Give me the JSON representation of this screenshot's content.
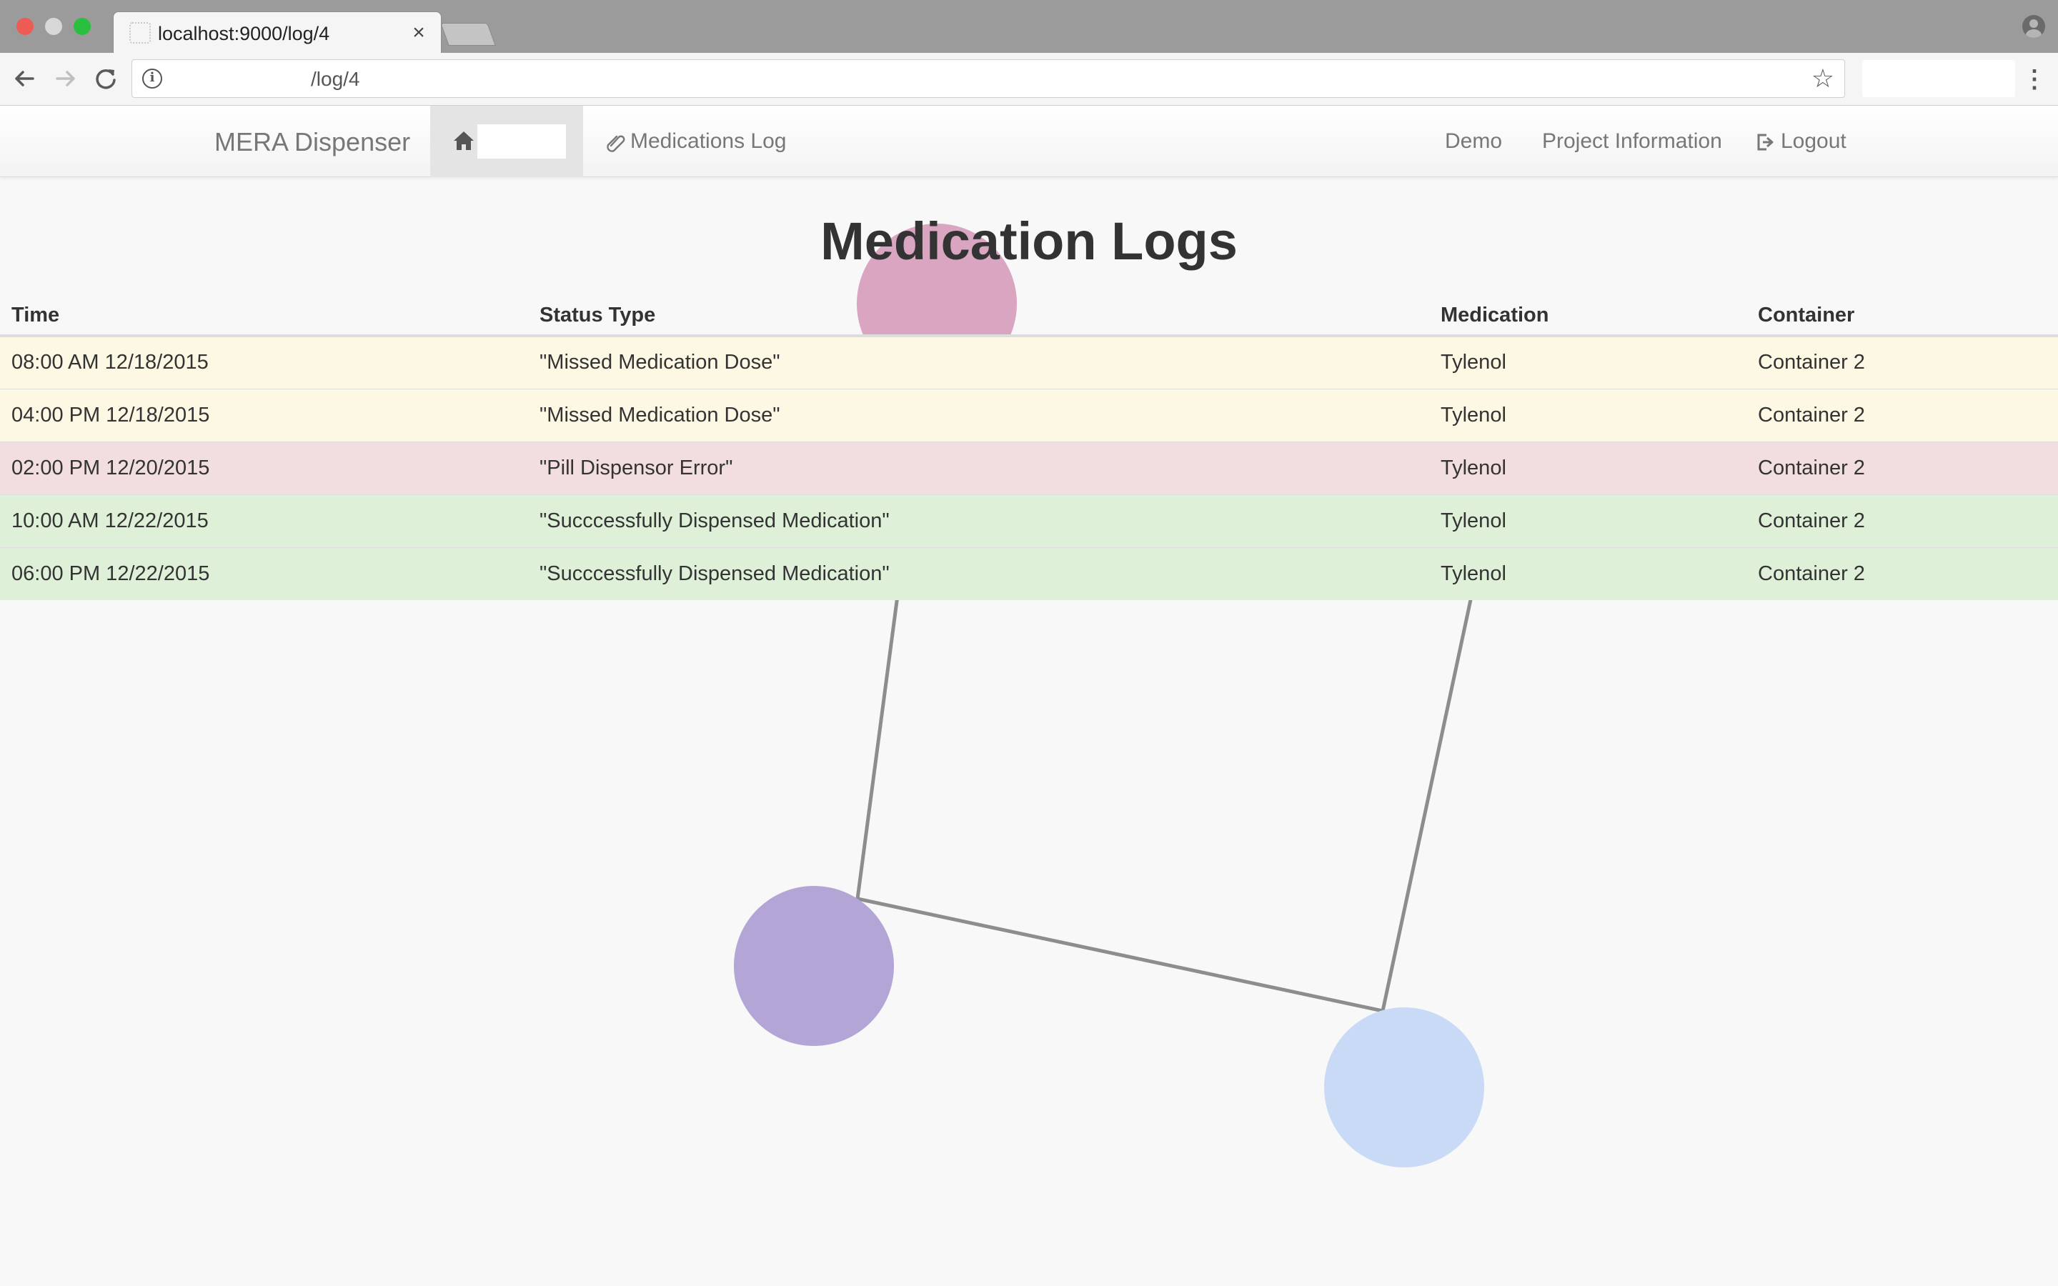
{
  "browser": {
    "tab_title": "localhost:9000/log/4",
    "tab_close": "×",
    "url": "/log/4",
    "icons": {
      "back": "arrow-left-icon",
      "forward": "arrow-right-icon",
      "reload": "reload-icon",
      "info": "info-icon",
      "bookmark": "star-icon",
      "menu": "kebab-menu-icon",
      "profile": "profile-icon"
    }
  },
  "navbar": {
    "brand": "MERA Dispenser",
    "home_icon": "home-icon",
    "links": {
      "medications": "Medications Log",
      "demo": "Demo",
      "project_info": "Project Information",
      "logout": "Logout"
    }
  },
  "page": {
    "title": "Medication Logs"
  },
  "table": {
    "headers": {
      "time": "Time",
      "status": "Status Type",
      "medication": "Medication",
      "container": "Container"
    },
    "rows": [
      {
        "time": "08:00 AM 12/18/2015",
        "status": "\"Missed Medication Dose\"",
        "medication": "Tylenol",
        "container": "Container 2",
        "state": "warning"
      },
      {
        "time": "04:00 PM 12/18/2015",
        "status": "\"Missed Medication Dose\"",
        "medication": "Tylenol",
        "container": "Container 2",
        "state": "warning"
      },
      {
        "time": "02:00 PM 12/20/2015",
        "status": "\"Pill Dispensor Error\"",
        "medication": "Tylenol",
        "container": "Container 2",
        "state": "danger"
      },
      {
        "time": "10:00 AM 12/22/2015",
        "status": "\"Succcessfully Dispensed Medication\"",
        "medication": "Tylenol",
        "container": "Container 2",
        "state": "success"
      },
      {
        "time": "06:00 PM 12/22/2015",
        "status": "\"Succcessfully Dispensed Medication\"",
        "medication": "Tylenol",
        "container": "Container 2",
        "state": "success"
      }
    ]
  },
  "colors": {
    "warning_row": "#fcf8e3",
    "danger_row": "#f2dede",
    "success_row": "#dff0d8",
    "node_pink": "#d9a5c0",
    "node_purple": "#b3a6d6",
    "node_blue": "#c9daf6"
  }
}
